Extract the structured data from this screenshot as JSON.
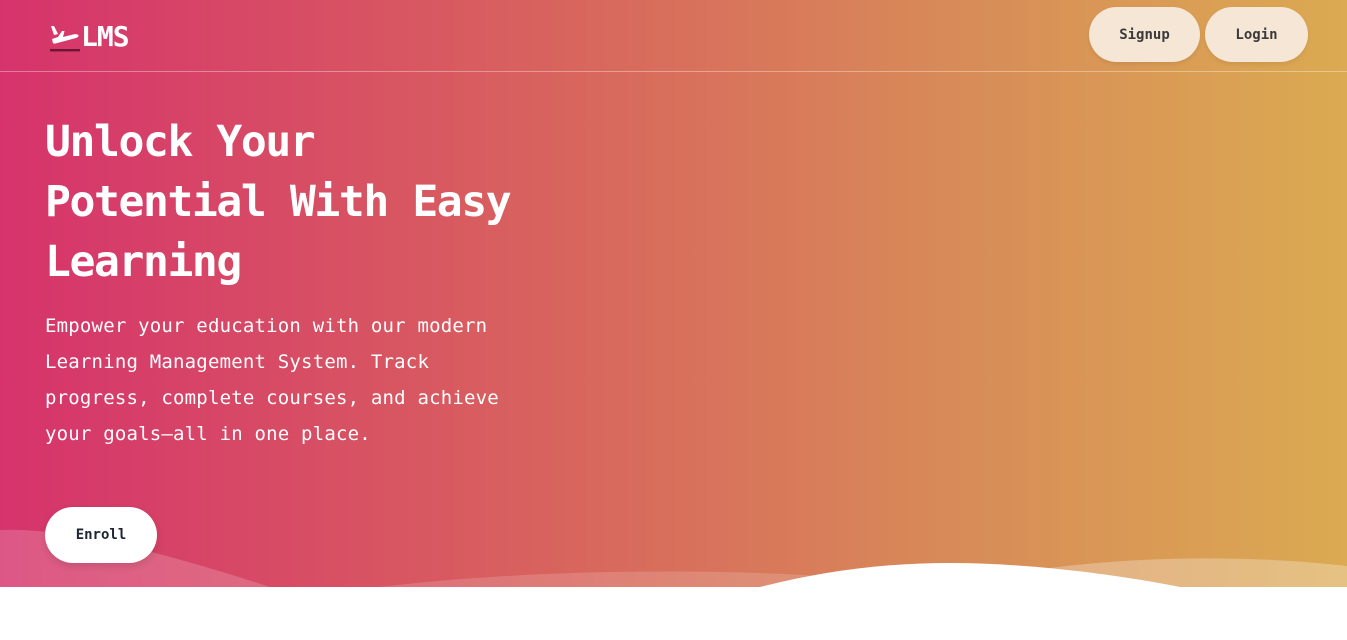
{
  "nav": {
    "logo_text": "LMS",
    "logo_icon": "airplane-takeoff-icon",
    "signup_label": "Signup",
    "login_label": "Login"
  },
  "hero": {
    "headline_line1": "Unlock Your",
    "headline_line2": "Potential With Easy",
    "headline_line3": "Learning",
    "description_line1": "Empower your education with our modern",
    "description_line2": "Learning Management System. Track",
    "description_line3": "progress, complete courses, and achieve",
    "description_line4": "your goals—all in one place.",
    "enroll_label": "Enroll"
  },
  "colors": {
    "gradient_start": "#d6336c",
    "gradient_end": "#dbaa52",
    "button_cream": "#f6e6d6",
    "text_white": "#ffffff"
  }
}
